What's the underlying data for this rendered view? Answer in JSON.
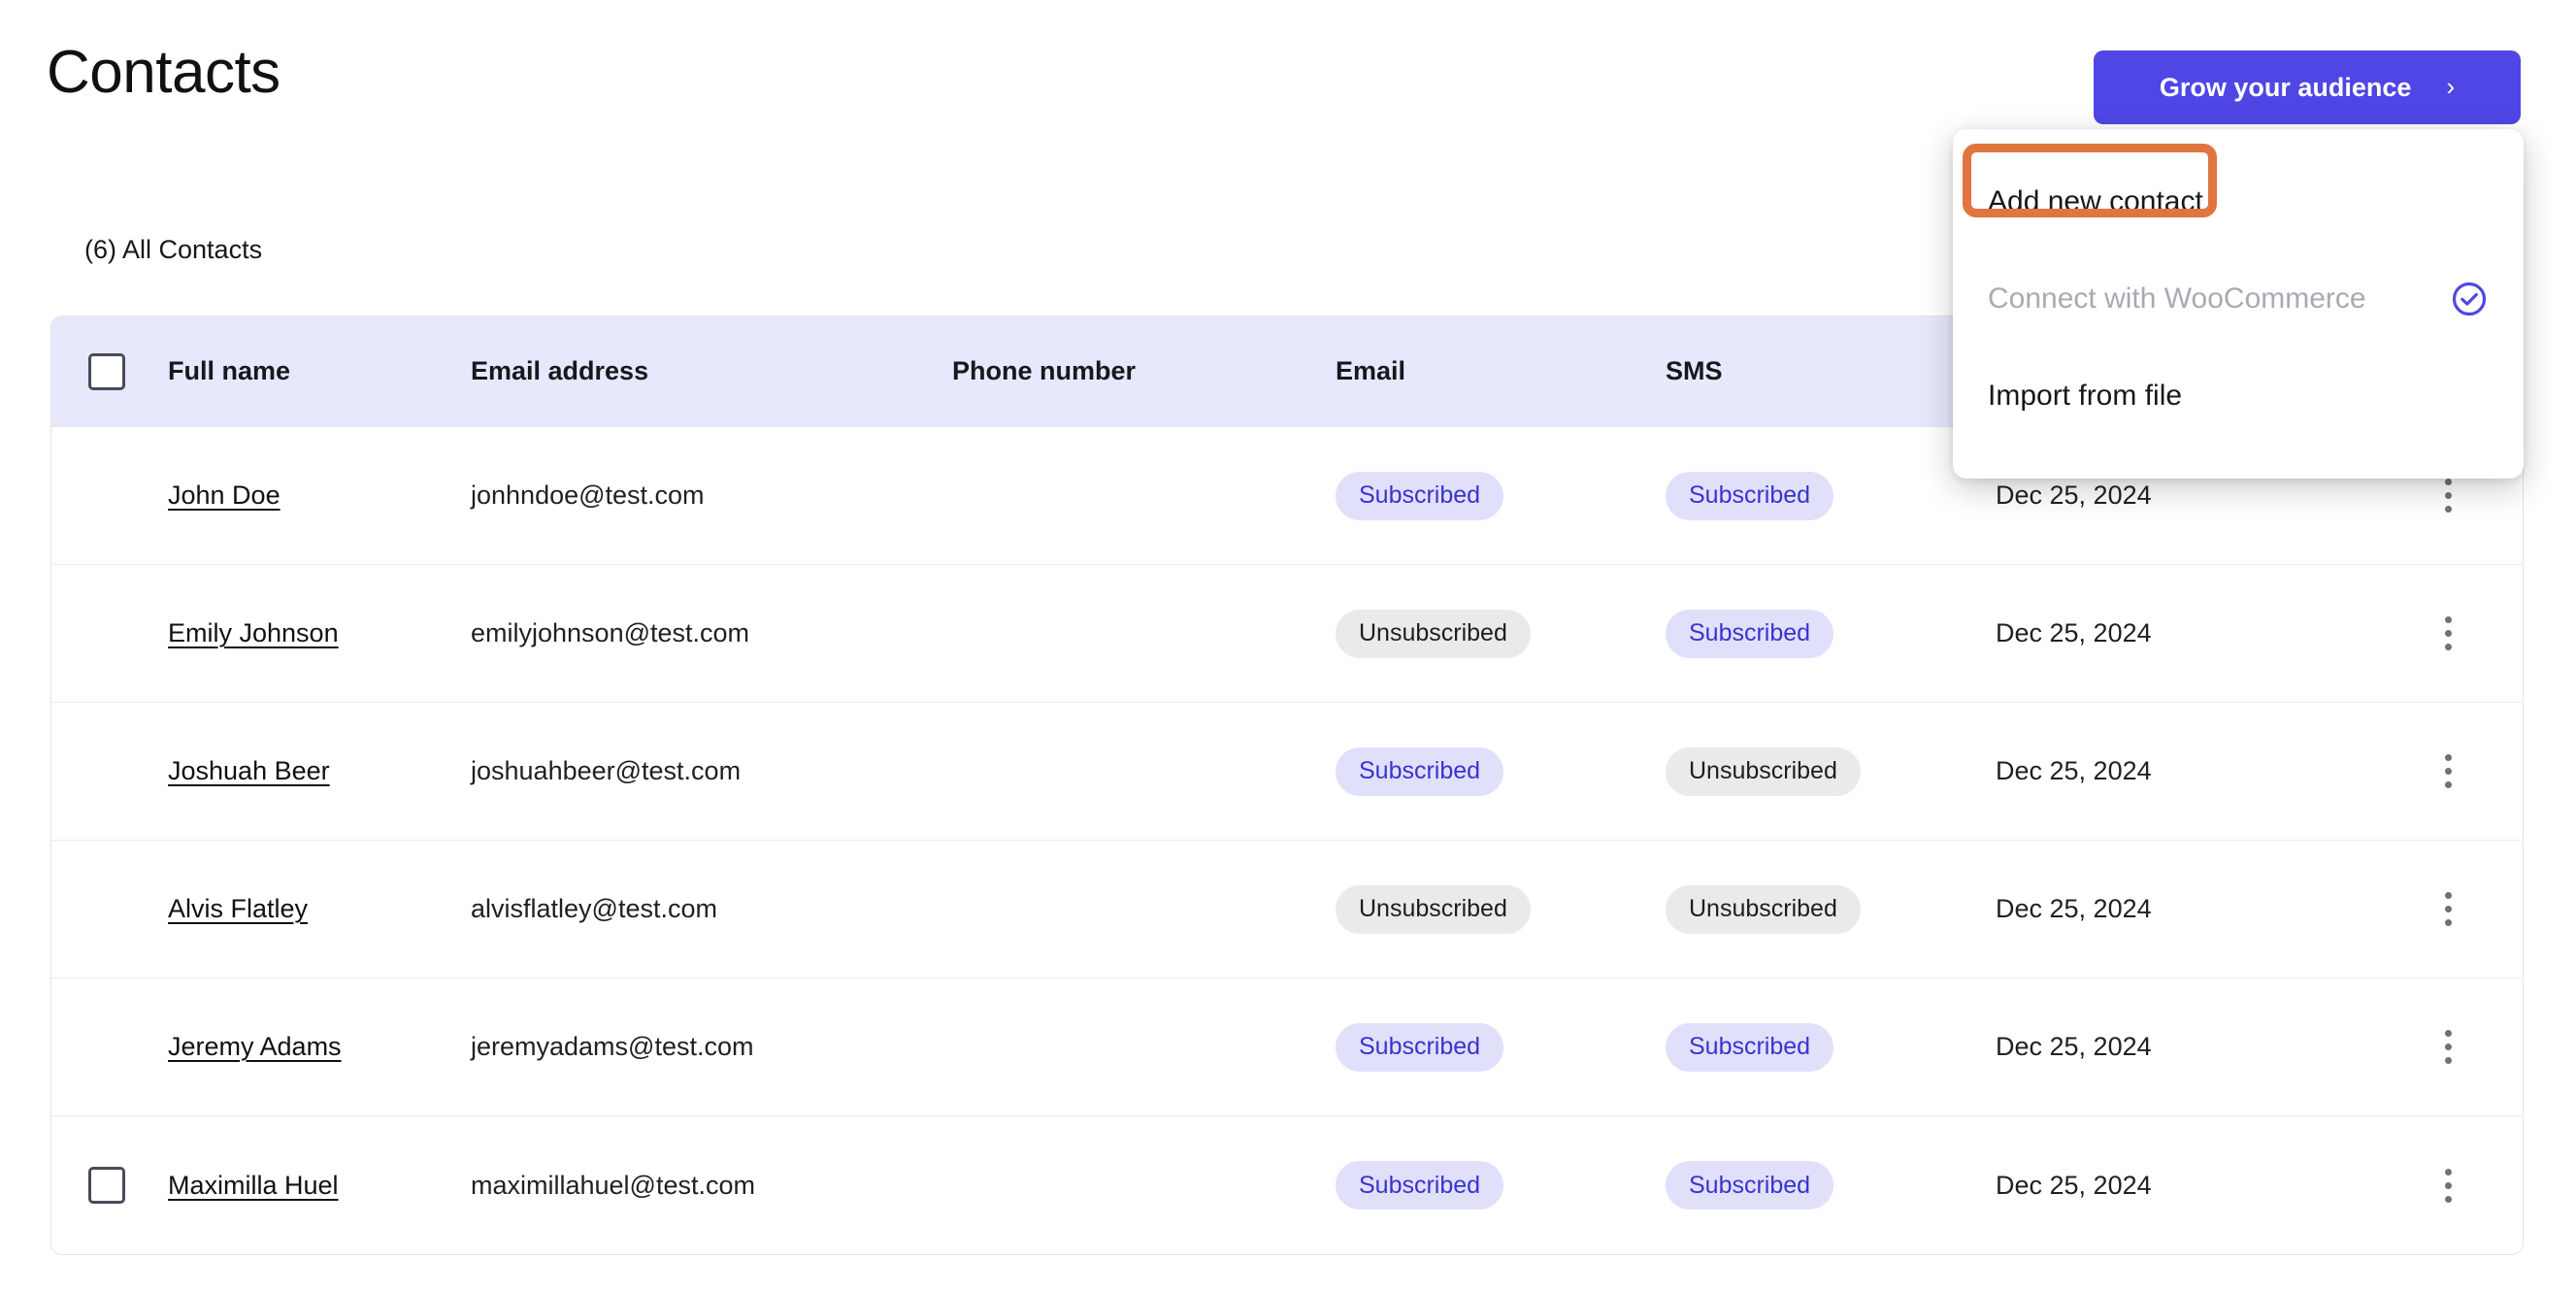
{
  "header": {
    "title": "Contacts",
    "grow_button": {
      "label": "Grow your audience",
      "chevron": "›",
      "color": "#4f46e5"
    }
  },
  "subtitle": "(6) All Contacts",
  "dropdown": {
    "items": [
      {
        "label": "Add new contact",
        "disabled": false,
        "icon": null,
        "highlighted": true
      },
      {
        "label": "Connect with WooCommerce",
        "disabled": true,
        "icon": "check-circle-icon",
        "highlighted": false
      },
      {
        "label": "Import from file",
        "disabled": false,
        "icon": null,
        "highlighted": false
      }
    ],
    "highlight_color": "#e0753f",
    "check_icon_color": "#4f46e5"
  },
  "table": {
    "columns": [
      "Full name",
      "Email address",
      "Phone number",
      "Email",
      "SMS"
    ],
    "header_background": "#e7e8fb",
    "rows": [
      {
        "checked": false,
        "checkbox_visible": false,
        "name": "John Doe",
        "email": "jonhndoe@test.com",
        "phone": "",
        "email_status": "Subscribed",
        "sms_status": "Subscribed",
        "date": "Dec 25, 2024"
      },
      {
        "checked": false,
        "checkbox_visible": false,
        "name": "Emily Johnson",
        "email": "emilyjohnson@test.com",
        "phone": "",
        "email_status": "Unsubscribed",
        "sms_status": "Subscribed",
        "date": "Dec 25, 2024"
      },
      {
        "checked": false,
        "checkbox_visible": false,
        "name": "Joshuah Beer",
        "email": "joshuahbeer@test.com",
        "phone": "",
        "email_status": "Subscribed",
        "sms_status": "Unsubscribed",
        "date": "Dec 25, 2024"
      },
      {
        "checked": false,
        "checkbox_visible": false,
        "name": "Alvis Flatley",
        "email": "alvisflatley@test.com",
        "phone": "",
        "email_status": "Unsubscribed",
        "sms_status": "Unsubscribed",
        "date": "Dec 25, 2024"
      },
      {
        "checked": false,
        "checkbox_visible": false,
        "name": "Jeremy Adams",
        "email": "jeremyadams@test.com",
        "phone": "",
        "email_status": "Subscribed",
        "sms_status": "Subscribed",
        "date": "Dec 25, 2024"
      },
      {
        "checked": false,
        "checkbox_visible": true,
        "name": "Maximilla Huel",
        "email": "maximillahuel@test.com",
        "phone": "",
        "email_status": "Subscribed",
        "sms_status": "Subscribed",
        "date": "Dec 25, 2024"
      }
    ],
    "badge_colors": {
      "subscribed_bg": "#e0e0fb",
      "subscribed_fg": "#3a33cf",
      "unsubscribed_bg": "#eaeaea",
      "unsubscribed_fg": "#1d1e21"
    }
  }
}
